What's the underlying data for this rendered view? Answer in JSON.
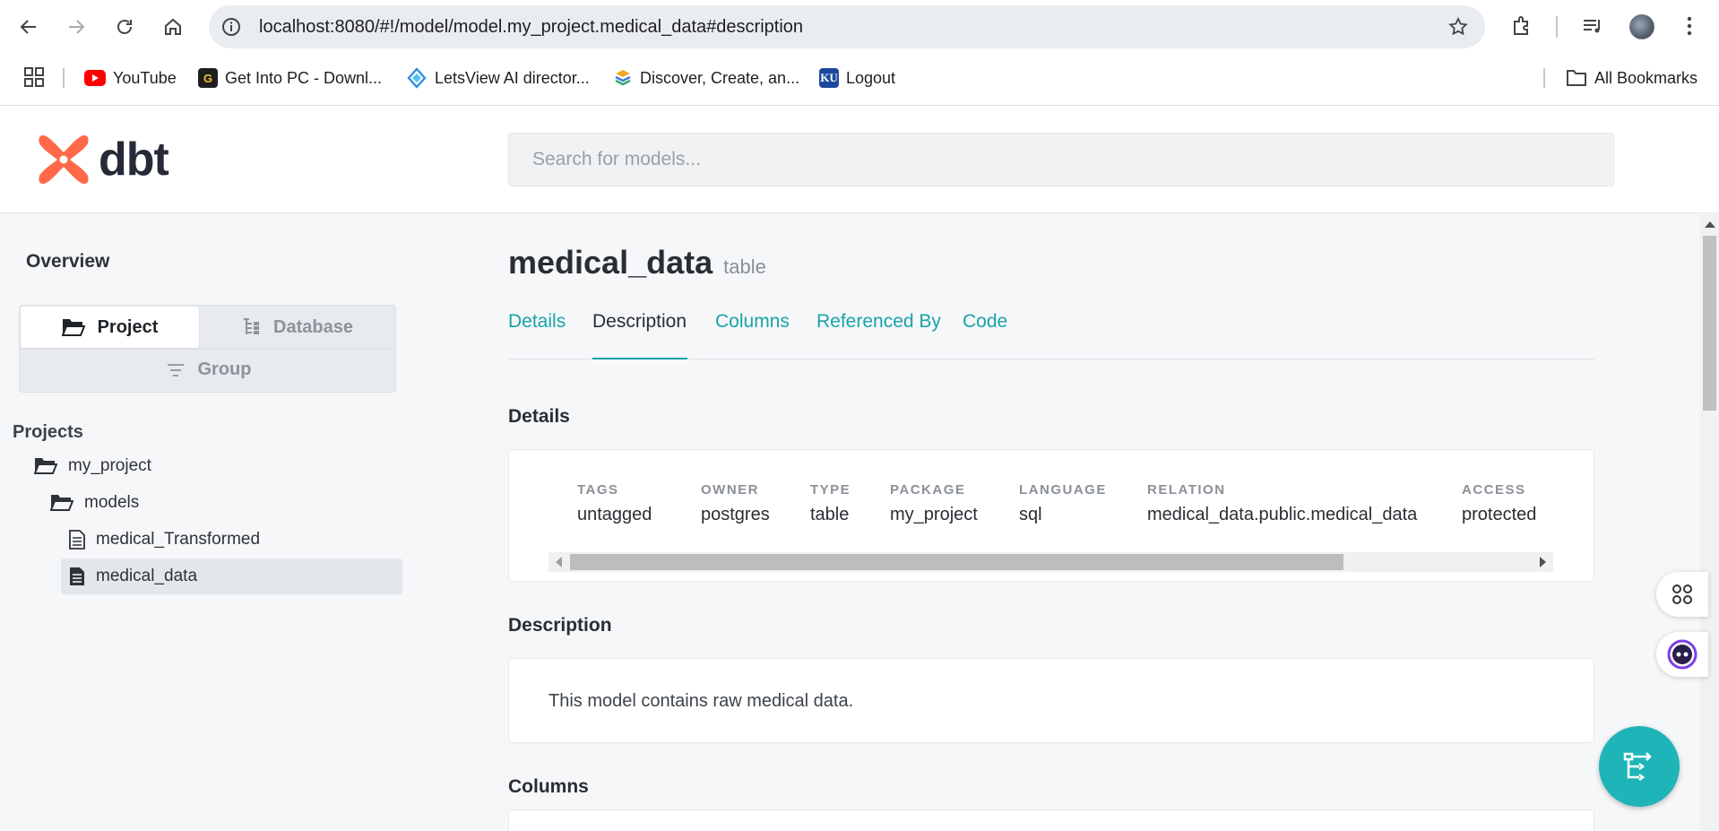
{
  "browser": {
    "url": "localhost:8080/#!/model/model.my_project.medical_data#description",
    "bookmarks": [
      {
        "label": "YouTube",
        "icon": "youtube-icon"
      },
      {
        "label": "Get Into PC - Downl...",
        "icon": "getintopc-icon"
      },
      {
        "label": "LetsView AI director...",
        "icon": "letsview-icon"
      },
      {
        "label": "Discover, Create, an...",
        "icon": "discover-icon"
      },
      {
        "label": "Logout",
        "icon": "ku-icon",
        "icon_text": "KU"
      }
    ],
    "all_bookmarks_label": "All Bookmarks"
  },
  "header": {
    "logo_text": "dbt",
    "search_placeholder": "Search for models..."
  },
  "sidebar": {
    "title": "Overview",
    "switcher": {
      "project_label": "Project",
      "database_label": "Database",
      "group_label": "Group",
      "active": "Project"
    },
    "section_label": "Projects",
    "tree": [
      {
        "label": "my_project",
        "type": "folder",
        "level": 0
      },
      {
        "label": "models",
        "type": "folder",
        "level": 1
      },
      {
        "label": "medical_Transformed",
        "type": "file",
        "level": 2
      },
      {
        "label": "medical_data",
        "type": "file",
        "level": 2,
        "active": true
      }
    ]
  },
  "main": {
    "model_name": "medical_data",
    "model_type": "table",
    "tabs": [
      "Details",
      "Description",
      "Columns",
      "Referenced By",
      "Code"
    ],
    "active_tab": "Description",
    "details_title": "Details",
    "details": [
      {
        "label": "TAGS",
        "value": "untagged"
      },
      {
        "label": "OWNER",
        "value": "postgres"
      },
      {
        "label": "TYPE",
        "value": "table"
      },
      {
        "label": "PACKAGE",
        "value": "my_project"
      },
      {
        "label": "LANGUAGE",
        "value": "sql"
      },
      {
        "label": "RELATION",
        "value": "medical_data.public.medical_data"
      },
      {
        "label": "ACCESS",
        "value": "protected"
      }
    ],
    "description_title": "Description",
    "description_text": "This model contains raw medical data.",
    "columns_title": "Columns"
  },
  "colors": {
    "accent": "#1aa3a8",
    "fab": "#1fb5b8",
    "logo": "#ff694a",
    "logo_text": "#262a38"
  }
}
